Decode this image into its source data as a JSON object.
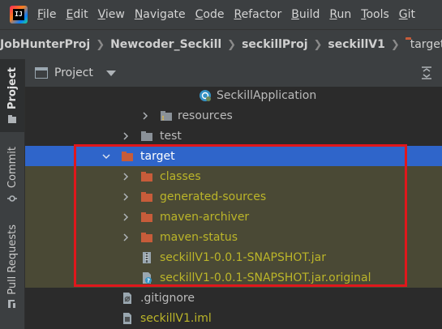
{
  "menu": {
    "items": [
      {
        "mnemonic": "F",
        "rest": "ile"
      },
      {
        "mnemonic": "E",
        "rest": "dit"
      },
      {
        "mnemonic": "V",
        "rest": "iew"
      },
      {
        "mnemonic": "N",
        "rest": "avigate"
      },
      {
        "mnemonic": "C",
        "rest": "ode"
      },
      {
        "mnemonic": "R",
        "rest": "efactor"
      },
      {
        "mnemonic": "B",
        "rest": "uild"
      },
      {
        "mnemonic": "R",
        "rest": "un"
      },
      {
        "mnemonic": "T",
        "rest": "ools"
      },
      {
        "mnemonic": "G",
        "rest": "it"
      }
    ]
  },
  "breadcrumb": [
    "JobHunterProj",
    "Newcoder_Seckill",
    "seckillProj",
    "seckillV1",
    "target"
  ],
  "toolstrip": {
    "project": "Project",
    "commit": "Commit",
    "pull_requests": "Pull Requests"
  },
  "panel": {
    "title": "Project"
  },
  "tree": {
    "items": [
      {
        "label": "SeckillApplication",
        "icon": "spring-class-icon"
      },
      {
        "label": "resources",
        "icon": "resources-folder-icon"
      },
      {
        "label": "test",
        "icon": "folder-icon"
      },
      {
        "label": "target",
        "icon": "excluded-folder-icon",
        "selected": true
      },
      {
        "label": "classes",
        "icon": "excluded-folder-icon"
      },
      {
        "label": "generated-sources",
        "icon": "excluded-folder-icon"
      },
      {
        "label": "maven-archiver",
        "icon": "excluded-folder-icon"
      },
      {
        "label": "maven-status",
        "icon": "excluded-folder-icon"
      },
      {
        "label": "seckillV1-0.0.1-SNAPSHOT.jar",
        "icon": "jar-icon"
      },
      {
        "label": "seckillV1-0.0.1-SNAPSHOT.jar.original",
        "icon": "unknown-file-icon"
      },
      {
        "label": ".gitignore",
        "icon": "gitignore-icon"
      },
      {
        "label": "seckillV1.iml",
        "icon": "iml-icon"
      }
    ]
  },
  "colors": {
    "selection": "#2f65ca",
    "excluded_text": "#bbb529",
    "excluded_folder": "#c75c3a",
    "annotation_box": "#e0171c"
  }
}
